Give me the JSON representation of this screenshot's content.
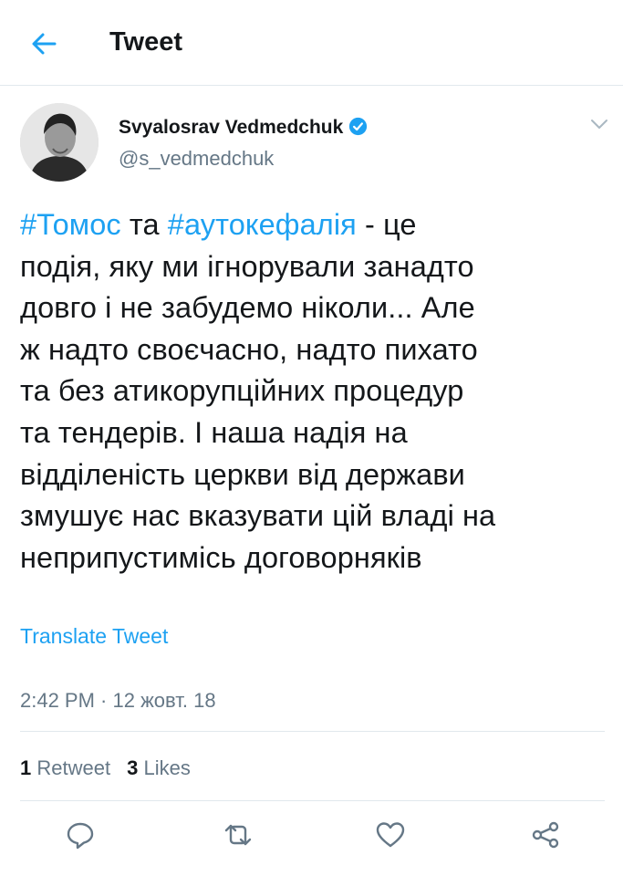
{
  "header": {
    "title": "Tweet"
  },
  "author": {
    "name": "Svyalosrav Vedmedchuk",
    "handle": "@s_vedmedchuk"
  },
  "tweet": {
    "lines": [
      {
        "hashtag1": "#Томос",
        "mid": " та ",
        "hashtag2": "#аутокефалія",
        "tail": " - це"
      },
      "подія, яку ми ігнорували занадто",
      "довго і не забудемо ніколи... Але",
      "ж надто своєчасно, надто пихато",
      "та без атикорупційних процедур",
      "та тендерів. І наша надія на",
      "відділеність церкви від держави",
      "змушує нас вказувати цій владі на",
      "неприпустимісь договорняків"
    ],
    "translate_label": "Translate Tweet",
    "timestamp": "2:42 PM · 12 жовт. 18"
  },
  "stats": {
    "retweets_count": "1",
    "retweets_label": "Retweet",
    "likes_count": "3",
    "likes_label": "Likes"
  },
  "colors": {
    "accent": "#1da1f2",
    "muted": "#657786",
    "text": "#14171a",
    "divider": "#e1e8ed"
  },
  "icons": [
    "back-arrow-icon",
    "verified-badge-icon",
    "chevron-down-icon",
    "reply-icon",
    "retweet-icon",
    "like-icon",
    "share-icon"
  ]
}
